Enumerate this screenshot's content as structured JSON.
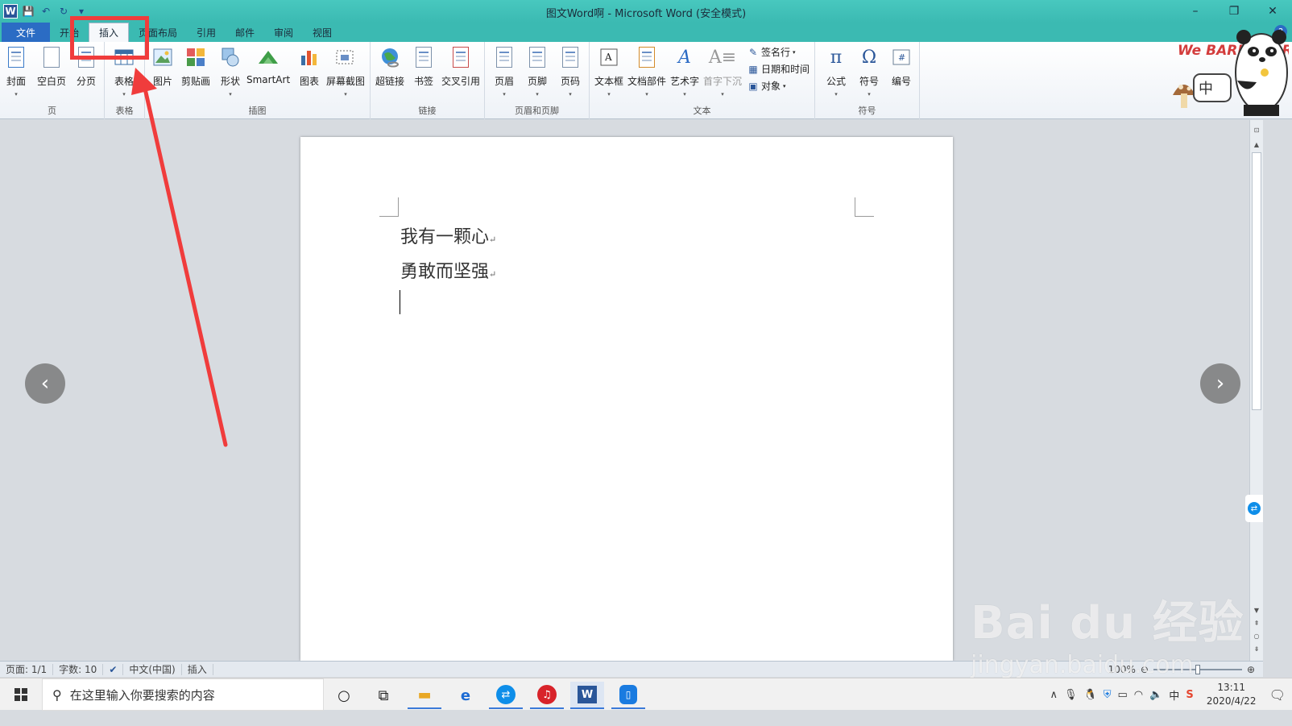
{
  "window": {
    "title": "图文Word啊 - Microsoft Word (安全模式)",
    "app_icon": "W",
    "controls": {
      "minimize": "–",
      "restore": "❐",
      "close": "✕"
    }
  },
  "quick_access": {
    "save_icon": "💾",
    "undo_icon": "↶",
    "redo_icon": "↻",
    "customize_icon": "▾"
  },
  "tabs": [
    {
      "label": "文件"
    },
    {
      "label": "开始"
    },
    {
      "label": "插入"
    },
    {
      "label": "页面布局"
    },
    {
      "label": "引用"
    },
    {
      "label": "邮件"
    },
    {
      "label": "审阅"
    },
    {
      "label": "视图"
    }
  ],
  "active_tab": "插入",
  "ribbon": {
    "groups": {
      "pages": "页",
      "tables": "表格",
      "illustrations": "插图",
      "links": "链接",
      "header_footer": "页眉和页脚",
      "text": "文本",
      "symbols": "符号"
    },
    "buttons": {
      "cover": "封面",
      "blank_page": "空白页",
      "page_break": "分页",
      "table": "表格",
      "picture": "图片",
      "clipart": "剪贴画",
      "shapes": "形状",
      "smartart": "SmartArt",
      "chart": "图表",
      "screenshot": "屏幕截图",
      "hyperlink": "超链接",
      "bookmark": "书签",
      "cross_ref": "交叉引用",
      "header": "页眉",
      "footer": "页脚",
      "page_number": "页码",
      "textbox": "文本框",
      "quick_parts": "文档部件",
      "wordart": "艺术字",
      "dropcap": "首字下沉",
      "signature": "签名行",
      "datetime": "日期和时间",
      "object": "对象",
      "equation": "公式",
      "symbol": "符号",
      "number": "编号"
    }
  },
  "document": {
    "lines": [
      "我有一颗心",
      "勇敢而坚强"
    ]
  },
  "status": {
    "page": "页面: 1/1",
    "words": "字数: 10",
    "language": "中文(中国)",
    "mode": "插入",
    "zoom": "100%"
  },
  "taskbar": {
    "search_placeholder": "在这里输入你要搜索的内容",
    "time": "13:11",
    "date": "2020/4/22",
    "ime": "中"
  },
  "watermark": {
    "brand": "Bai du 经验",
    "url": "jingyan.baidu.com"
  },
  "decor": {
    "bears_title": "We BARE BEARS",
    "bears_badge": "中"
  },
  "colors": {
    "title_bar": "#3bbab2",
    "file_tab": "#2b6cc4",
    "annotation": "#f03c3c"
  }
}
